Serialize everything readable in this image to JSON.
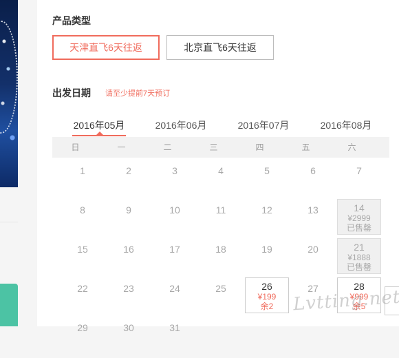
{
  "product": {
    "title": "产品类型",
    "options": [
      {
        "label": "天津直飞6天往返",
        "active": true
      },
      {
        "label": "北京直飞6天往返",
        "active": false
      }
    ]
  },
  "departure": {
    "title": "出发日期",
    "hint": "请至少提前7天预订",
    "months": [
      "2016年05月",
      "2016年06月",
      "2016年07月",
      "2016年08月"
    ],
    "active_month": "2016年05月",
    "weekdays": [
      "日",
      "一",
      "二",
      "三",
      "四",
      "五",
      "六"
    ],
    "rows": [
      [
        {
          "d": "1"
        },
        {
          "d": "2"
        },
        {
          "d": "3"
        },
        {
          "d": "4"
        },
        {
          "d": "5"
        },
        {
          "d": "6"
        },
        {
          "d": "7"
        }
      ],
      [
        {
          "d": "8"
        },
        {
          "d": "9"
        },
        {
          "d": "10"
        },
        {
          "d": "11"
        },
        {
          "d": "12"
        },
        {
          "d": "13"
        },
        {
          "d": "14",
          "price": "¥2999",
          "status": "已售罄"
        }
      ],
      [
        {
          "d": "15"
        },
        {
          "d": "16"
        },
        {
          "d": "17"
        },
        {
          "d": "18"
        },
        {
          "d": "19"
        },
        {
          "d": "20"
        },
        {
          "d": "21",
          "price": "¥1888",
          "status": "已售罄"
        }
      ],
      [
        {
          "d": "22"
        },
        {
          "d": "23"
        },
        {
          "d": "24"
        },
        {
          "d": "25"
        },
        {
          "d": "26",
          "price": "¥199",
          "status": "余2"
        },
        {
          "d": "27"
        },
        {
          "d": "28",
          "price": "¥999",
          "status": "余5"
        }
      ],
      [
        {
          "d": "29"
        },
        {
          "d": "30"
        },
        {
          "d": "31"
        }
      ]
    ]
  },
  "watermark": "Lvtting.net"
}
